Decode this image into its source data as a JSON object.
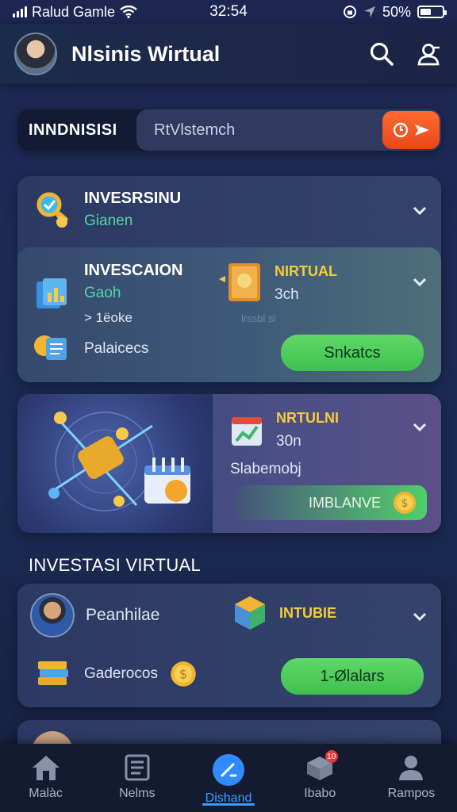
{
  "status_bar": {
    "carrier": "Ralud Gamle",
    "time": "32:54",
    "battery_percent": "50%",
    "battery_level": 0.5
  },
  "header": {
    "title": "Nlsinis Wirtual",
    "icons": [
      "search-icon",
      "user-icon"
    ]
  },
  "search": {
    "label": "INNDNISISI",
    "placeholder": "RtVlstemch",
    "button_icons": [
      "clock-icon",
      "send-icon"
    ]
  },
  "card1": {
    "row1": {
      "title": "INVESRSINU",
      "subtitle": "Gianen"
    },
    "row2": {
      "title": "INVESCAION",
      "subtitle": "Gaoh",
      "meta": "> 1ëoke"
    },
    "row2_right": {
      "title": "NIRTUAL",
      "value": "3ch",
      "faded": "lrssbl sl"
    },
    "row3": {
      "label": "Palaicecs",
      "button": "Snkatcs"
    }
  },
  "card2": {
    "title": "NRTULNI",
    "value": "30n",
    "label": "Slabemobj",
    "button": "IMBLANVE"
  },
  "section_title": "INVESTASI VIRTUAL",
  "card3": {
    "person_label": "Peanhilae",
    "right_title": "INTUBIE",
    "row2_label": "Gaderocos",
    "button": "1-Ølalars"
  },
  "bottom_nav": {
    "items": [
      {
        "label": "Malàc",
        "icon": "home-icon"
      },
      {
        "label": "Nelms",
        "icon": "list-icon"
      },
      {
        "label": "Dishand",
        "icon": "pen-icon"
      },
      {
        "label": "Ibabo",
        "icon": "box-icon"
      },
      {
        "label": "Rampos",
        "icon": "person-icon"
      }
    ],
    "active": "Dishand",
    "badge": "10"
  },
  "colors": {
    "accent_blue": "#3d9bff",
    "orange_button": "#ff6a2f",
    "green_button": "#4fcf6a",
    "green_text": "#52d6a3",
    "yellow_text": "#f4cc3c"
  }
}
